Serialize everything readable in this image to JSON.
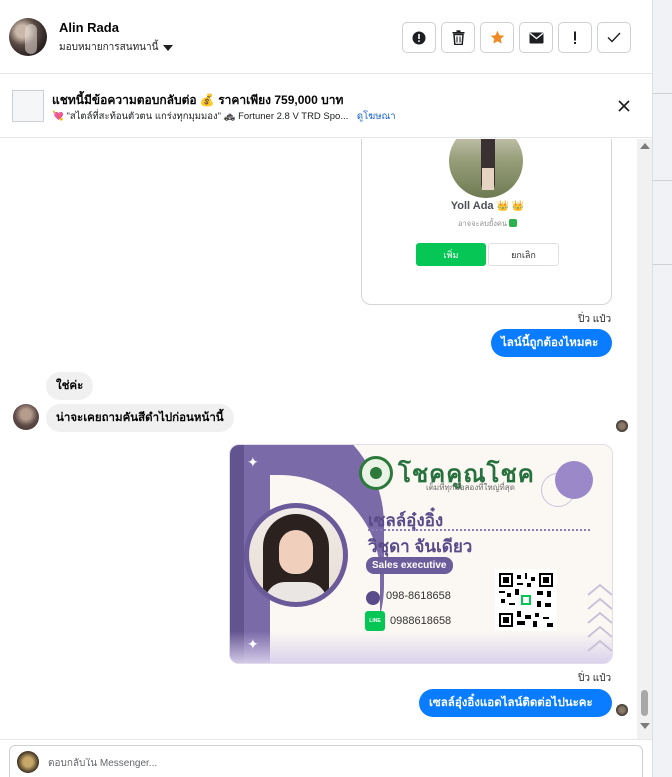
{
  "header": {
    "contact_name": "Alin Rada",
    "assign_label": "มอบหมายการสนทนานี้"
  },
  "actions": [
    {
      "name": "spam-button",
      "icon": "alert-circle-icon"
    },
    {
      "name": "delete-button",
      "icon": "trash-icon"
    },
    {
      "name": "star-button",
      "icon": "star-icon"
    },
    {
      "name": "mark-unread-button",
      "icon": "envelope-icon"
    },
    {
      "name": "follow-up-button",
      "icon": "exclamation-icon"
    },
    {
      "name": "mark-done-button",
      "icon": "checkmark-icon"
    }
  ],
  "banner": {
    "title": "แชทนี้มีข้อความตอบกลับต่อ 💰 ราคาเพียง 759,000 บาท",
    "subtitle": "💘 \"สไตล์ที่สะท้อนตัวตน แกร่งทุกมุมมอง\" 🚓 Fortuner 2.8 V TRD Spo...",
    "ad_link": "ดูโฆษณา"
  },
  "card_line_add": {
    "display_name": "Yoll Ada",
    "crowns": "👑 👑",
    "status": "อาจจะลบยั้งคน",
    "add_button": "เพิ่ม",
    "cancel_button": "ยกเลิก"
  },
  "messages": {
    "sender_1": "ปิ่ว แป๋ว",
    "out_1": "ไลน์นี้ถูกต้องไหมคะ",
    "in_1": "ใช่ค่ะ",
    "in_2": "น่าจะเคยถามคันสีดำไปก่อนหน้านี้",
    "sender_2": "ปิ่ว แป๋ว",
    "out_2": "เซลล์อุ๋งอิ๋งแอดไลน์ติดต่อไปนะคะ"
  },
  "business_card": {
    "brand": "โชคคูณโชค",
    "slogan": "เต็มที่ทุกมือสองที่ใหญ่ที่สุด",
    "nickname": "เซลล์อุ๋งอิ๋ง",
    "full_name": "วิชุดา จันเดียว",
    "role": "Sales executive",
    "phone": "098-8618658",
    "line_badge": "LINE",
    "line_id": "0988618658"
  },
  "composer": {
    "placeholder": "ตอบกลับใน Messenger..."
  },
  "colors": {
    "messenger_blue": "#0a7cff",
    "line_green": "#06c755",
    "card_purple": "#6b5c9c",
    "brand_green": "#26713d"
  }
}
